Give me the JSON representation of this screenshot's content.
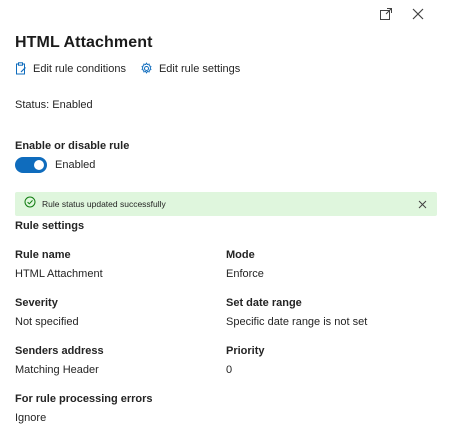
{
  "window": {
    "popout_icon": "popout-icon",
    "close_icon": "close-icon"
  },
  "title": "HTML Attachment",
  "actions": {
    "edit_conditions_label": "Edit rule conditions",
    "edit_conditions_icon": "clipboard-edit-icon",
    "edit_settings_label": "Edit rule settings",
    "edit_settings_icon": "gear-icon"
  },
  "status_line": "Status: Enabled",
  "toggle": {
    "heading": "Enable or disable rule",
    "state_label": "Enabled",
    "on": true
  },
  "banner": {
    "message": "Rule status updated successfully",
    "icon": "success-check-icon",
    "color": "#dff6dd"
  },
  "settings": {
    "section_title": "Rule settings",
    "rule_name": {
      "label": "Rule name",
      "value": "HTML Attachment"
    },
    "mode": {
      "label": "Mode",
      "value": "Enforce"
    },
    "severity": {
      "label": "Severity",
      "value": "Not specified"
    },
    "date_range": {
      "label": "Set date range",
      "value": "Specific date range is not set"
    },
    "senders": {
      "label": "Senders address",
      "value": "Matching Header"
    },
    "priority": {
      "label": "Priority",
      "value": "0"
    },
    "errors": {
      "label": "For rule processing errors",
      "value": "Ignore"
    }
  },
  "colors": {
    "accent": "#0f6cbd",
    "success_bg": "#dff6dd",
    "text": "#242424"
  }
}
